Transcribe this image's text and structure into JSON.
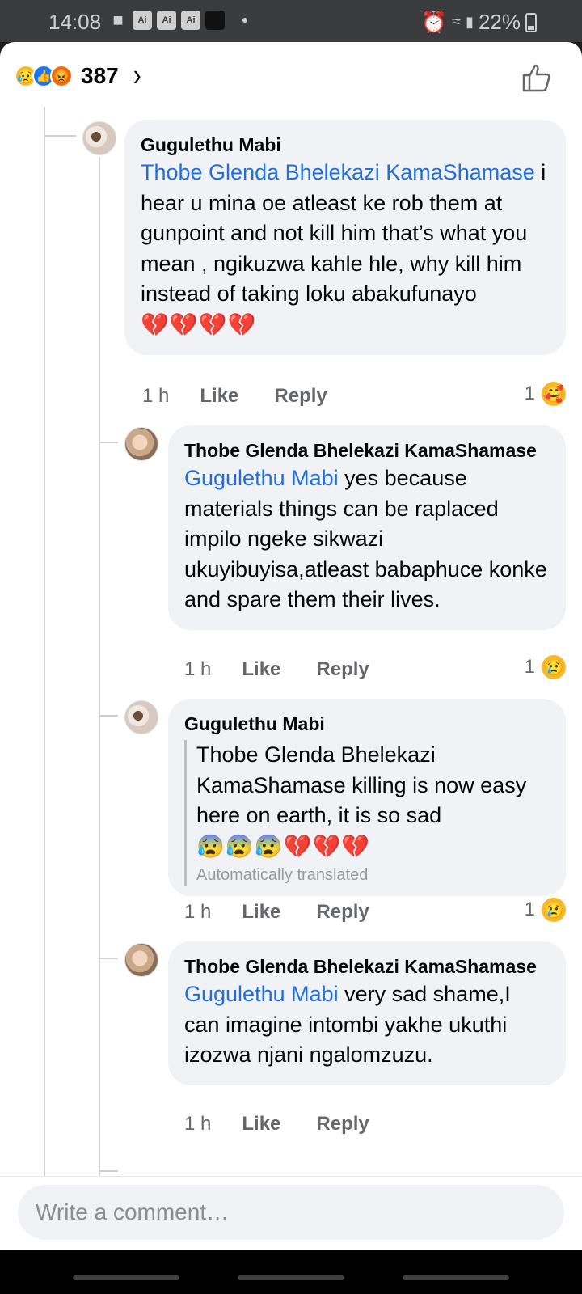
{
  "status_bar": {
    "time": "14:08",
    "app_icons": [
      "Ai",
      "Ai",
      "Ai"
    ],
    "battery": "22%"
  },
  "header": {
    "reaction_count": "387",
    "reactions": [
      "sad",
      "like",
      "angry"
    ]
  },
  "comments": [
    {
      "author": "Gugulethu Mabi",
      "mention": "Thobe Glenda Bhelekazi KamaShamase",
      "text": " i hear u mina oe atleast ke rob them at gunpoint and not kill him that’s what you mean , ngikuzwa kahle hle, why kill him instead of taking loku abakufunayo",
      "emojis": "💔💔💔💔",
      "time": "1 h",
      "like_label": "Like",
      "reply_label": "Reply",
      "reaction_count": "1",
      "reaction_emoji": "🥰"
    },
    {
      "author": "Thobe Glenda Bhelekazi KamaShamase",
      "mention": "Gugulethu Mabi",
      "text": " yes because materials things can be raplaced impilo ngeke sikwazi ukuyibuyisa,atleast babaphuce konke and spare them their lives.",
      "time": "1 h",
      "like_label": "Like",
      "reply_label": "Reply",
      "reaction_count": "1",
      "reaction_emoji": "😢"
    },
    {
      "author": "Gugulethu Mabi",
      "text": "Thobe Glenda Bhelekazi KamaShamase killing is now easy here on earth, it is so sad",
      "emojis": "😰😰😰💔💔💔",
      "translated_label": "Automatically translated",
      "time": "1 h",
      "like_label": "Like",
      "reply_label": "Reply",
      "reaction_count": "1",
      "reaction_emoji": "😢"
    },
    {
      "author": "Thobe Glenda Bhelekazi KamaShamase",
      "mention": "Gugulethu Mabi",
      "text": " very sad shame,I can imagine intombi yakhe ukuthi izozwa njani ngalomzuzu.",
      "time": "1 h",
      "like_label": "Like",
      "reply_label": "Reply"
    }
  ],
  "composer": {
    "placeholder": "Write a comment…"
  }
}
